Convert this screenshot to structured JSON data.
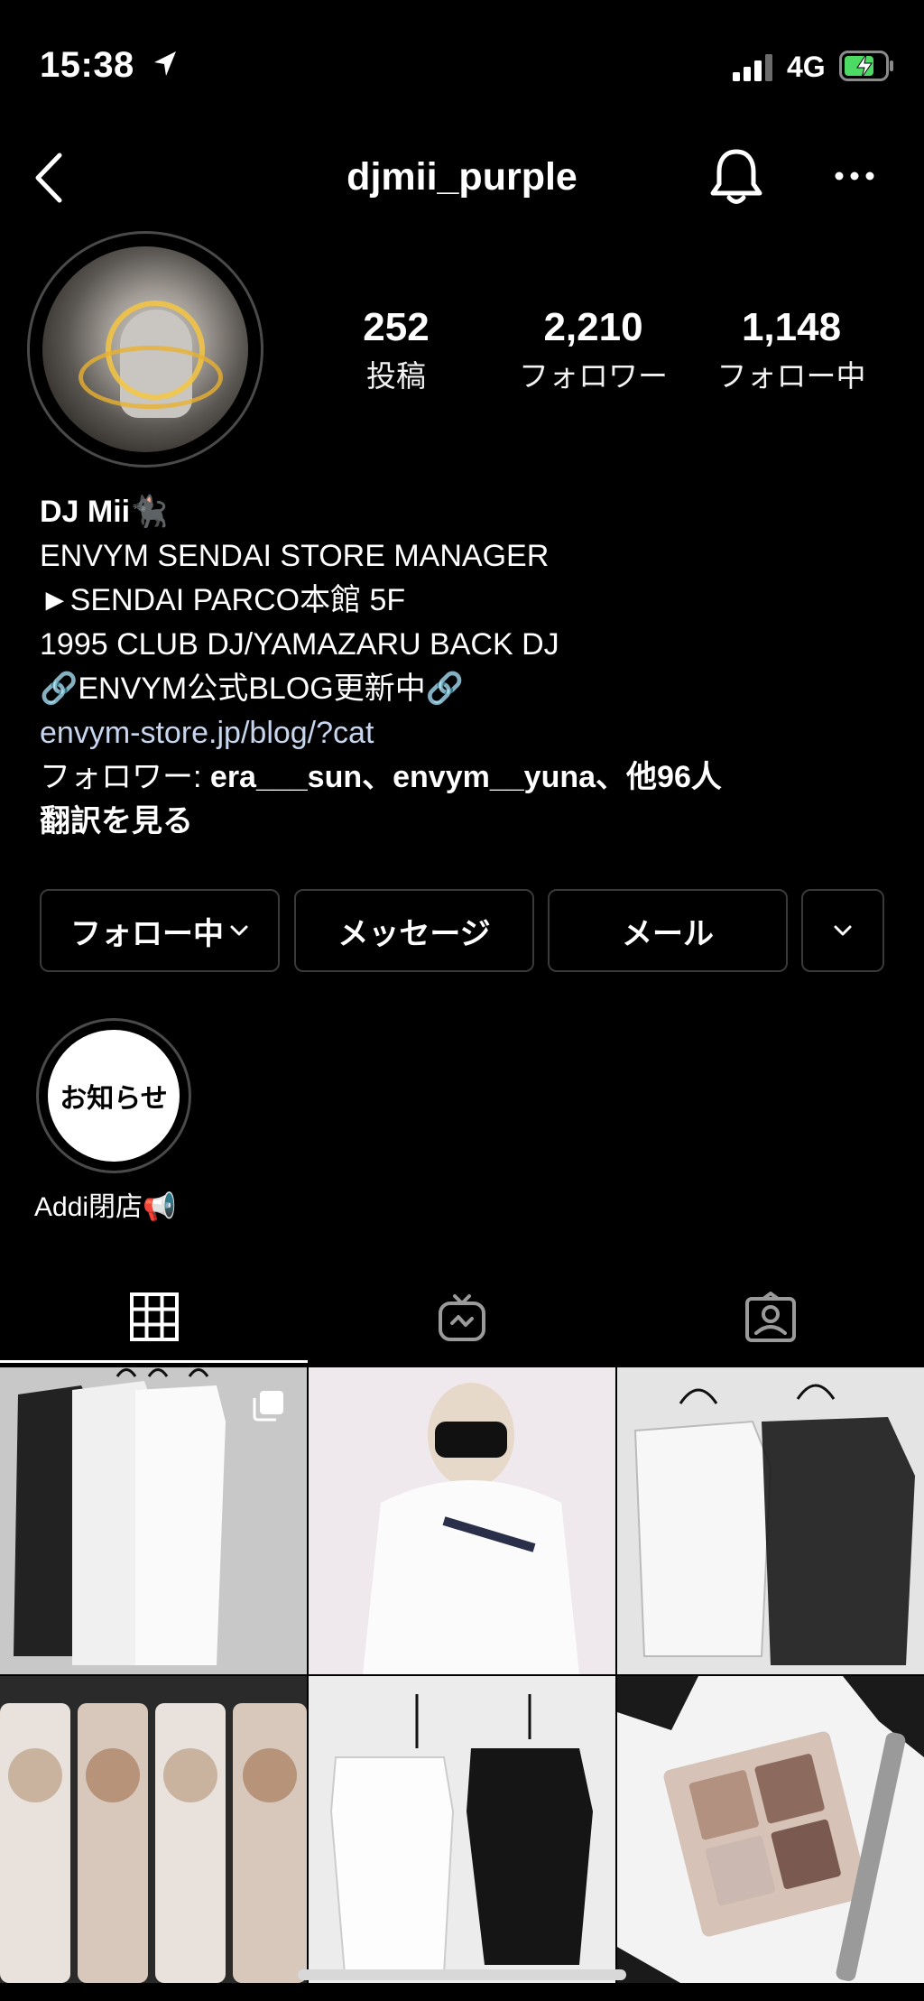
{
  "status_bar": {
    "time": "15:38",
    "network": "4G"
  },
  "header": {
    "username": "djmii_purple"
  },
  "stats": [
    {
      "value": "252",
      "label": "投稿"
    },
    {
      "value": "2,210",
      "label": "フォロワー"
    },
    {
      "value": "1,148",
      "label": "フォロー中"
    }
  ],
  "bio": {
    "display_name": "DJ Mii🐈‍⬛",
    "lines": [
      "ENVYM SENDAI STORE MANAGER",
      "►SENDAI PARCO本館 5F",
      "1995 CLUB DJ/YAMAZARU BACK DJ",
      "🔗ENVYM公式BLOG更新中🔗"
    ],
    "link": "envym-store.jp/blog/?cat",
    "followers_prefix": "フォロワー: ",
    "followers_names": "era___sun、envym__yuna、他96人",
    "translate": "翻訳を見る"
  },
  "buttons": {
    "following": "フォロー中",
    "message": "メッセージ",
    "mail": "メール"
  },
  "highlight": {
    "cover_text": "お知らせ",
    "label": "Addi閉店📢"
  },
  "colors": {
    "background": "#000000",
    "link": "#c7d6ef",
    "button_border": "#3a3a3a"
  },
  "icons": [
    "location-arrow-icon",
    "signal-icon",
    "battery-charging-icon",
    "back-chevron-icon",
    "bell-icon",
    "more-icon",
    "chevron-down-icon",
    "grid-icon",
    "igtv-icon",
    "tagged-icon",
    "multi-post-icon"
  ]
}
